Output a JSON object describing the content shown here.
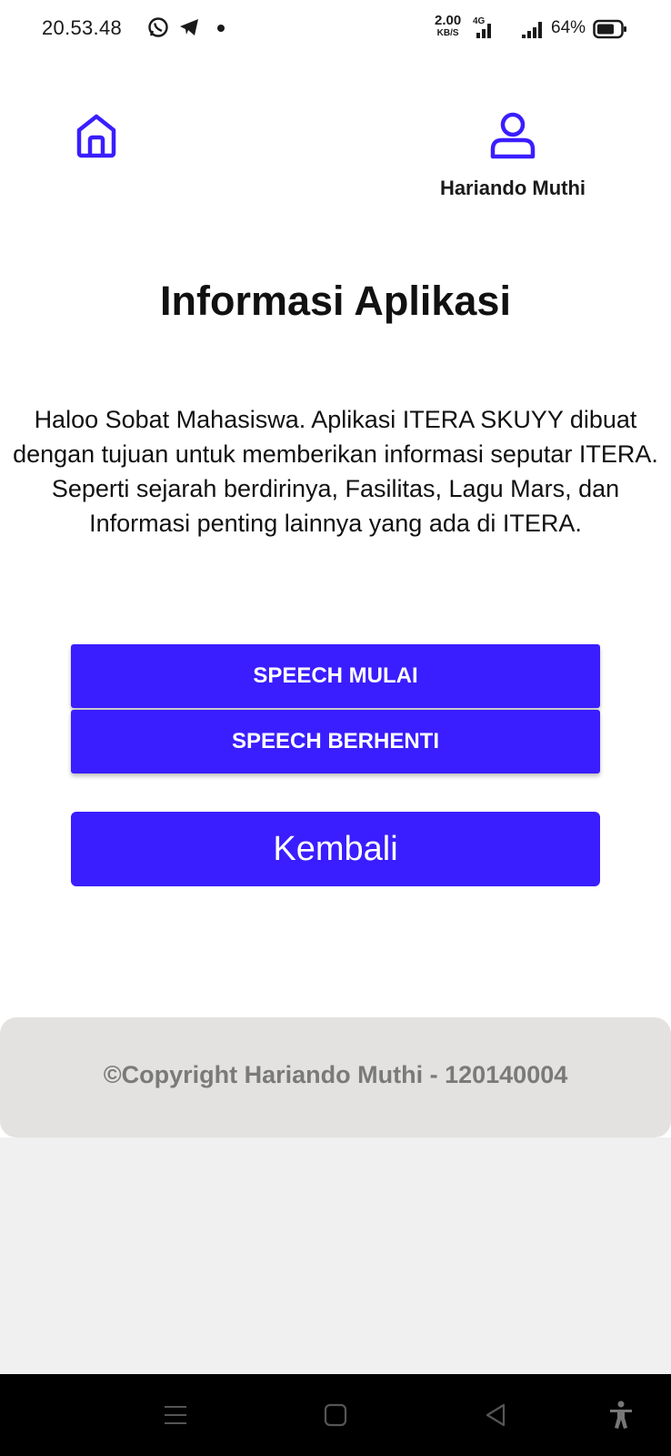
{
  "status_bar": {
    "time": "20.53.48",
    "net_speed_value": "2.00",
    "net_speed_unit": "KB/S",
    "network_type": "4G",
    "battery": "64%",
    "icons": [
      "whatsapp-icon",
      "telegram-icon",
      "dot-icon",
      "signal-icon",
      "battery-icon"
    ]
  },
  "header": {
    "home_icon": "home-icon",
    "profile_icon": "user-icon",
    "profile_name": "Hariando Muthi"
  },
  "main": {
    "title": "Informasi Aplikasi",
    "description": "Haloo Sobat Mahasiswa. Aplikasi ITERA SKUYY dibuat dengan tujuan untuk memberikan informasi seputar ITERA. Seperti sejarah berdirinya, Fasilitas, Lagu Mars, dan Informasi penting lainnya yang ada di ITERA.",
    "speech_start_label": "SPEECH MULAI",
    "speech_stop_label": "SPEECH BERHENTI",
    "back_label": "Kembali"
  },
  "footer": {
    "copyright": "©Copyright Hariando Muthi - 120140004"
  },
  "colors": {
    "accent": "#3a1eff",
    "footer_bg": "#e3e2e0",
    "footer_text": "#7a7a7a"
  }
}
